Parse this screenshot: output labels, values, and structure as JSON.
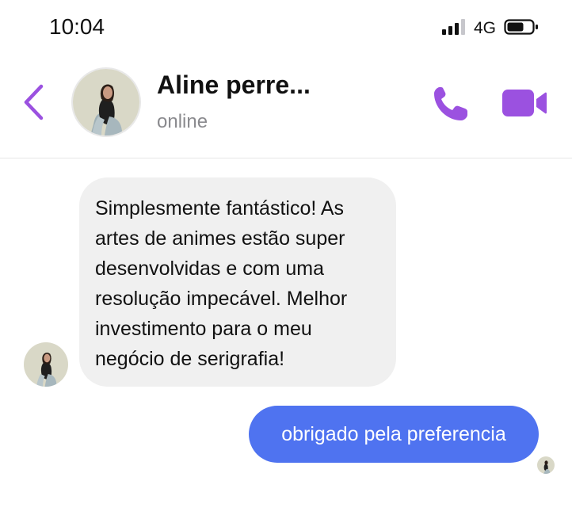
{
  "status_bar": {
    "time": "10:04",
    "network": "4G",
    "signal_bars_active": 3,
    "signal_bars_total": 4
  },
  "header": {
    "contact_name": "Aline perre...",
    "contact_status": "online",
    "accent_color": "#9b51e0"
  },
  "messages": [
    {
      "direction": "incoming",
      "text": "Simplesmente fantástico! As artes de animes estão super desenvolvidas e com uma resolução impecável. Melhor investimento para o meu negócio de serigrafia!",
      "bubble_color": "#f0f0f0"
    },
    {
      "direction": "outgoing",
      "text": "obrigado pela preferencia",
      "bubble_color": "#4f73f0"
    }
  ],
  "icons": {
    "back": "chevron-left-icon",
    "call": "phone-icon",
    "video": "video-camera-icon",
    "battery": "battery-icon",
    "signal": "signal-icon"
  }
}
